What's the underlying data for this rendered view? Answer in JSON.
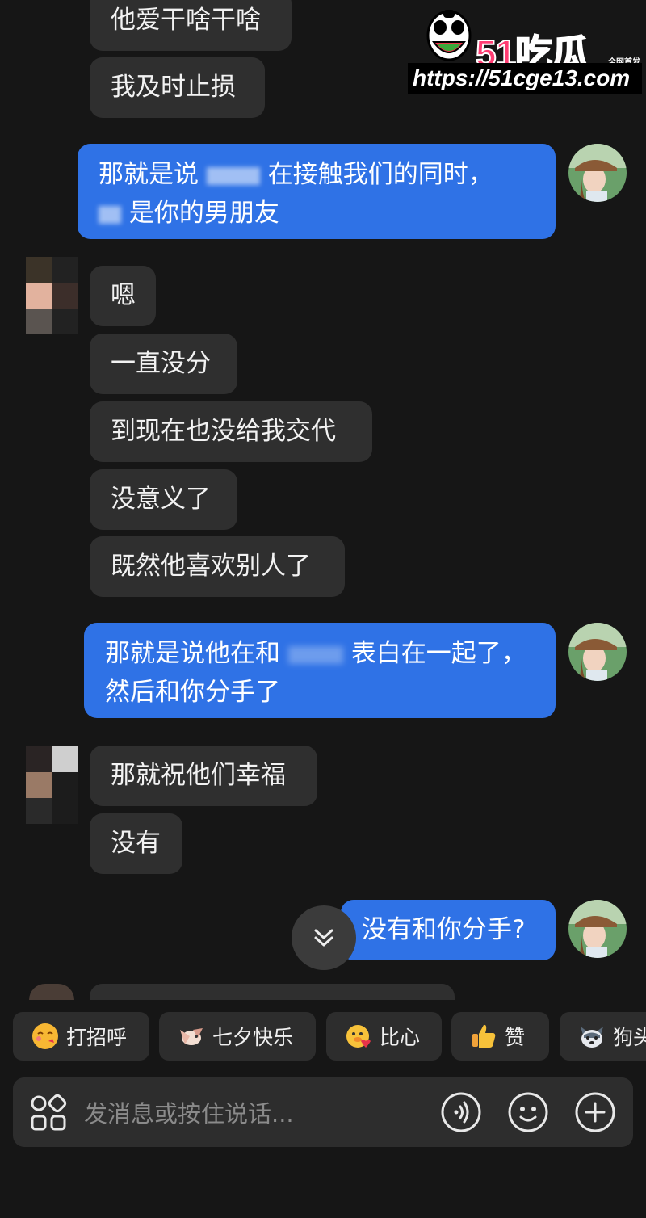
{
  "messages": {
    "m1": "他爱干啥干啥",
    "m2": "我及时止损",
    "m3_line1": "那就是说",
    "m3_line1_b": "在接触我们的同时，",
    "m3_line2": "是你的男朋友",
    "m4": "嗯",
    "m5": "一直没分",
    "m6": "到现在也没给我交代",
    "m7": "没意义了",
    "m8": "既然他喜欢别人了",
    "m9_line1a": "那就是说他在和",
    "m9_line1b": "表白在一起了，",
    "m9_line2": "然后和你分手了",
    "m10": "那就祝他们幸福",
    "m11": "没有",
    "m12": "没有和你分手?"
  },
  "watermark": {
    "title": "51吃瓜",
    "tag": "全网首发",
    "url": "https://51cge13.com"
  },
  "quick_replies": [
    {
      "label": "打招呼",
      "icon": "smile-kiss-emoji-icon"
    },
    {
      "label": "七夕快乐",
      "icon": "bird-emoji-icon"
    },
    {
      "label": "比心",
      "icon": "duck-heart-emoji-icon"
    },
    {
      "label": "赞",
      "icon": "thumbs-up-emoji-icon"
    },
    {
      "label": "狗头",
      "icon": "dog-head-emoji-icon"
    }
  ],
  "composer": {
    "placeholder": "发消息或按住说话..."
  },
  "colors": {
    "background": "#161616",
    "incoming_bubble": "#2f2f2f",
    "outgoing_bubble": "#2f72e6",
    "watermark_pink": "#ff3d73"
  }
}
